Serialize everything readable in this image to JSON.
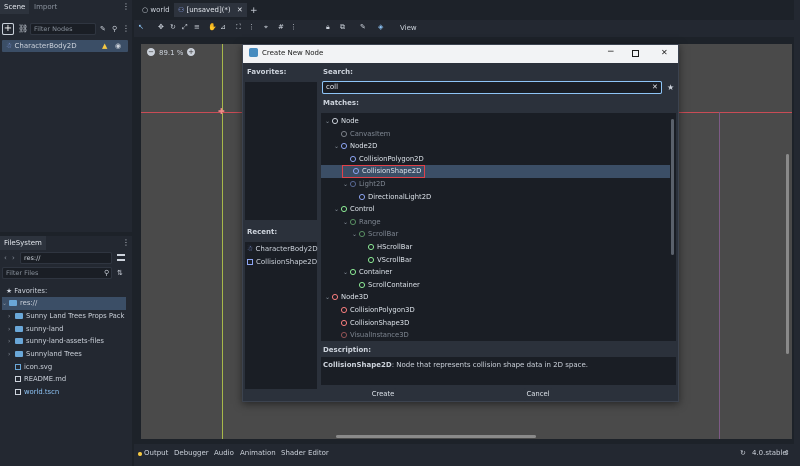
{
  "scene_dock": {
    "tabs": [
      "Scene",
      "Import"
    ],
    "filter_placeholder": "Filter Nodes",
    "root_node": "CharacterBody2D"
  },
  "filesystem": {
    "title": "FileSystem",
    "path": "res://",
    "filter_placeholder": "Filter Files",
    "items": [
      {
        "label": "Favorites:",
        "type": "favorites"
      },
      {
        "label": "res://",
        "type": "root"
      },
      {
        "label": "Sunny Land Trees Props Pack",
        "type": "folder"
      },
      {
        "label": "sunny-land",
        "type": "folder"
      },
      {
        "label": "sunny-land-assets-files",
        "type": "folder"
      },
      {
        "label": "Sunnyland Trees",
        "type": "folder"
      },
      {
        "label": "icon.svg",
        "type": "file"
      },
      {
        "label": "README.md",
        "type": "file"
      },
      {
        "label": "world.tscn",
        "type": "scene"
      }
    ]
  },
  "editor": {
    "tabs": [
      "world",
      "[unsaved](*)"
    ],
    "view_label": "View",
    "zoom": "89.1 %"
  },
  "bottom_bar": {
    "tabs": [
      "Output",
      "Debugger",
      "Audio",
      "Animation",
      "Shader Editor"
    ],
    "version": "4.0.stable"
  },
  "dialog": {
    "title": "Create New Node",
    "favorites_label": "Favorites:",
    "recent_label": "Recent:",
    "recent": [
      "CharacterBody2D",
      "CollisionShape2D"
    ],
    "search_label": "Search:",
    "search_value": "coll",
    "matches_label": "Matches:",
    "tree": [
      {
        "label": "Node",
        "depth": 0,
        "color": "#cdd3dc",
        "dim": false
      },
      {
        "label": "CanvasItem",
        "depth": 1,
        "color": "#cdd3dc",
        "dim": true
      },
      {
        "label": "Node2D",
        "depth": 1,
        "color": "#8da5f3",
        "dim": false
      },
      {
        "label": "CollisionPolygon2D",
        "depth": 2,
        "color": "#8da5f3",
        "dim": false
      },
      {
        "label": "CollisionShape2D",
        "depth": 2,
        "color": "#8da5f3",
        "dim": false,
        "selected": true
      },
      {
        "label": "Light2D",
        "depth": 2,
        "color": "#8da5f3",
        "dim": true
      },
      {
        "label": "DirectionalLight2D",
        "depth": 3,
        "color": "#8da5f3",
        "dim": false
      },
      {
        "label": "Control",
        "depth": 1,
        "color": "#8eef97",
        "dim": false
      },
      {
        "label": "Range",
        "depth": 2,
        "color": "#8eef97",
        "dim": true
      },
      {
        "label": "ScrollBar",
        "depth": 3,
        "color": "#8eef97",
        "dim": true
      },
      {
        "label": "HScrollBar",
        "depth": 4,
        "color": "#8eef97",
        "dim": false
      },
      {
        "label": "VScrollBar",
        "depth": 4,
        "color": "#8eef97",
        "dim": false
      },
      {
        "label": "Container",
        "depth": 2,
        "color": "#8eef97",
        "dim": false
      },
      {
        "label": "ScrollContainer",
        "depth": 3,
        "color": "#8eef97",
        "dim": false
      },
      {
        "label": "Node3D",
        "depth": 0,
        "color": "#fc7f7f",
        "dim": false
      },
      {
        "label": "CollisionPolygon3D",
        "depth": 1,
        "color": "#fc7f7f",
        "dim": false
      },
      {
        "label": "CollisionShape3D",
        "depth": 1,
        "color": "#fc7f7f",
        "dim": false
      },
      {
        "label": "VisualInstance3D",
        "depth": 1,
        "color": "#fc7f7f",
        "dim": true
      }
    ],
    "description_label": "Description:",
    "description_name": "CollisionShape2D",
    "description_text": ": Node that represents collision shape data in 2D space.",
    "create_label": "Create",
    "cancel_label": "Cancel",
    "accent": "#e0424a"
  }
}
